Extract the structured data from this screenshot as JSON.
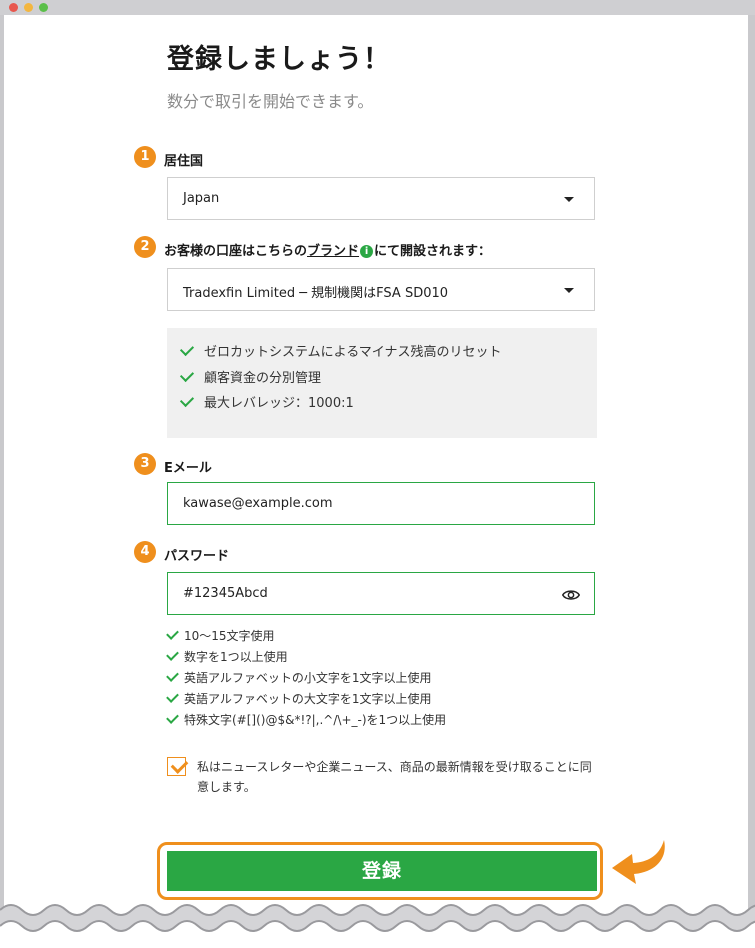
{
  "heading": {
    "title": "登録しましょう！",
    "subtitle": "数分で取引を開始できます。"
  },
  "steps": {
    "s1": "1",
    "s2": "2",
    "s3": "3",
    "s4": "4"
  },
  "country": {
    "label": "居住国",
    "value": "Japan"
  },
  "brand": {
    "label_before": "お客様の口座はこちらの",
    "label_link": "ブランド",
    "info_glyph": "i",
    "label_after": "にて開設されます：",
    "value": "Tradexfin Limited ─ 規制機関はFSA SD010"
  },
  "benefits": [
    "ゼロカットシステムによるマイナス残高のリセット",
    "顧客資金の分別管理",
    "最大レバレッジ：1000:1"
  ],
  "email": {
    "label": "Eメール",
    "value": "kawase@example.com"
  },
  "password": {
    "label": "パスワード",
    "value": "#12345Abcd",
    "rules": [
      "10～15文字使用",
      "数字を1つ以上使用",
      "英語アルファベットの小文字を1文字以上使用",
      "英語アルファベットの大文字を1文字以上使用",
      "特殊文字(#[]()@$&*!?|,.^/\\+_-)を1つ以上使用"
    ]
  },
  "consent": {
    "checked": true,
    "text": "私はニュースレターや企業ニュース、商品の最新情報を受け取ることに同意します。"
  },
  "submit": {
    "label": "登録"
  },
  "colors": {
    "accent_orange": "#ef8f1d",
    "brand_green": "#2aa744"
  }
}
